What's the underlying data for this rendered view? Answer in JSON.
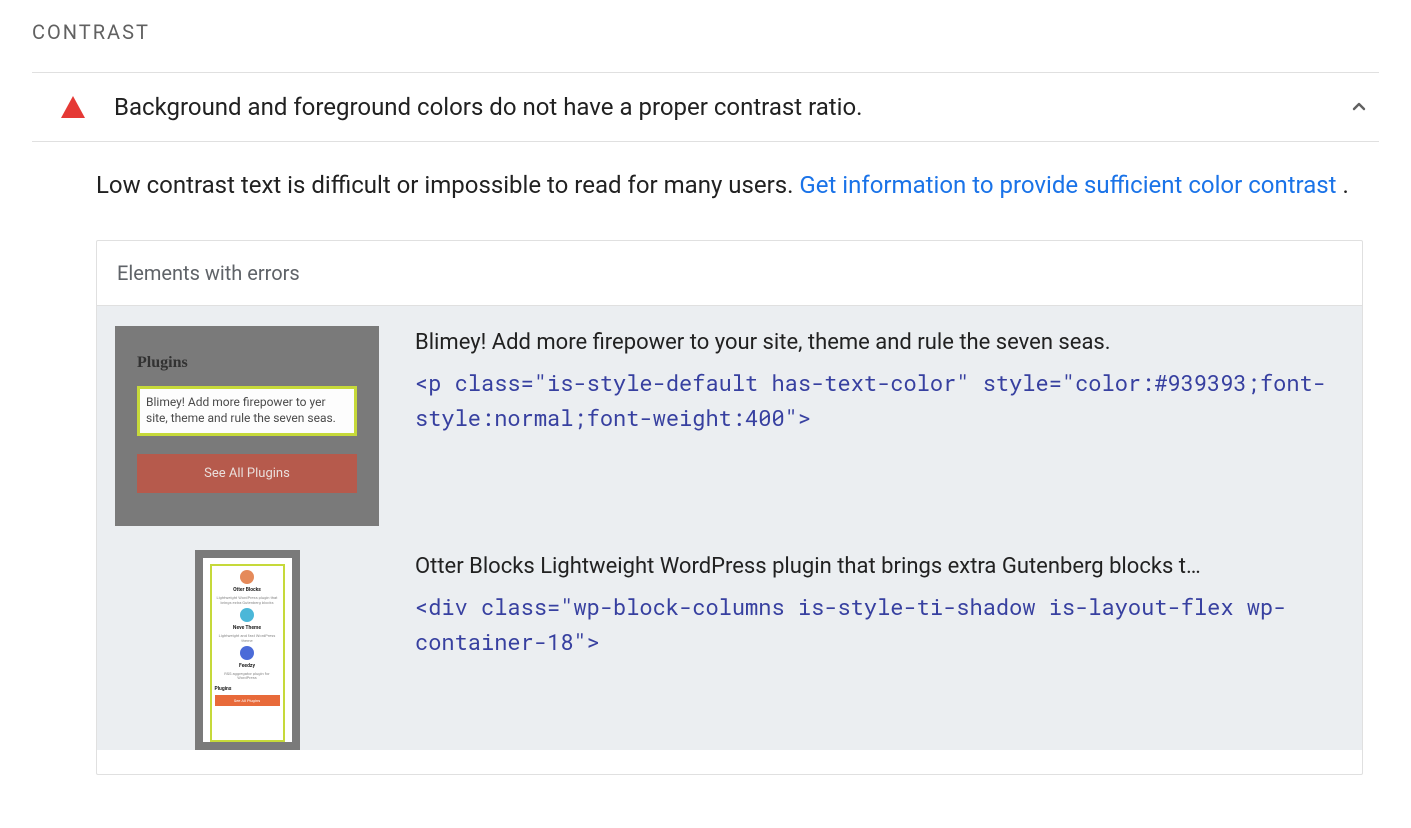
{
  "section_title": "CONTRAST",
  "audit": {
    "title": "Background and foreground colors do not have a proper contrast ratio.",
    "icon": "warning-triangle",
    "description_prefix": "Low contrast text is difficult or impossible to read for many users. ",
    "link_text": "Get information to provide sufficient color contrast",
    "description_suffix": " ."
  },
  "panel": {
    "heading": "Elements with errors",
    "items": [
      {
        "thumb": {
          "type": "plugins-card",
          "heading": "Plugins",
          "highlight_text": "Blimey! Add more firepower to yer site, theme and rule the seven seas.",
          "button_label": "See All Plugins"
        },
        "snippet_text": "Blimey! Add more firepower to your site, theme and rule the seven seas.",
        "code": "<p class=\"is-style-default has-text-color\" style=\"color:#939393;font-style:normal;font-weight:400\">"
      },
      {
        "thumb": {
          "type": "mobile-column",
          "blocks": [
            {
              "dot": "#e58a5a",
              "title": "Otter Blocks",
              "sub": "Lightweight WordPress plugin that brings extra Gutenberg blocks"
            },
            {
              "dot": "#4bb7d8",
              "title": "Neve Theme",
              "sub": "Lightweight and fast WordPress theme"
            },
            {
              "dot": "#4b6bd8",
              "title": "Feedzy",
              "sub": "RSS aggregator plugin for WordPress"
            }
          ],
          "footer_heading": "Plugins",
          "footer_button": "See All Plugins"
        },
        "snippet_text": "Otter Blocks Lightweight WordPress plugin that brings extra Gutenberg blocks t…",
        "code": "<div class=\"wp-block-columns is-style-ti-shadow is-layout-flex wp-container-18\">"
      }
    ]
  }
}
